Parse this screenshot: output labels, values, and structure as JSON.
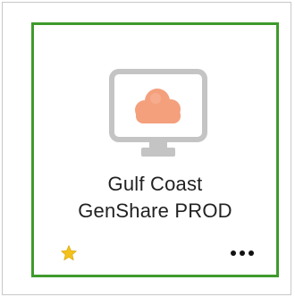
{
  "tile": {
    "title_line1": "Gulf Coast",
    "title_line2": "GenShare PROD",
    "icon": "monitor-cloud-icon",
    "favorite_icon": "star-icon",
    "more_icon": "more-options-icon"
  },
  "colors": {
    "selected_border": "#3f9a2c",
    "monitor": "#c4c4c4",
    "cloud": "#f4a07c",
    "star": "#f3c21b",
    "text": "#222222"
  }
}
